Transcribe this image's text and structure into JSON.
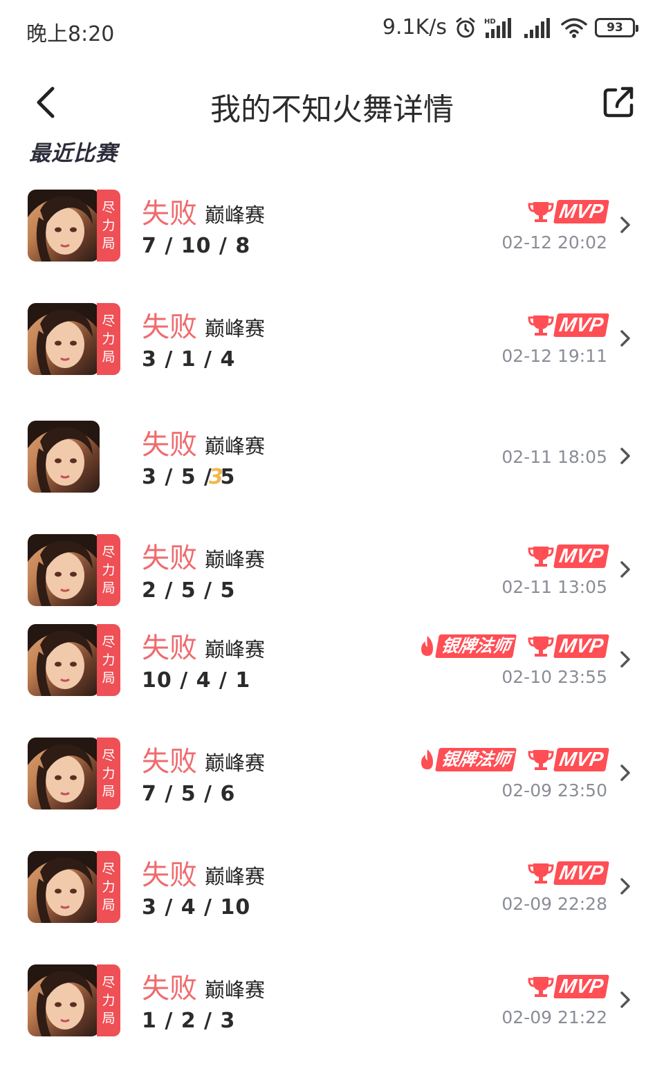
{
  "status_bar": {
    "time": "晚上8:20",
    "net_speed": "9.1K/s",
    "battery": "93"
  },
  "header": {
    "title": "我的不知火舞详情"
  },
  "section_title": "最近比赛",
  "matches": [
    {
      "badge": [
        "尽",
        "力",
        "局"
      ],
      "result": "失败",
      "mode": "巅峰赛",
      "kda": "7 / 10 / 8",
      "mvp_label": "MVP",
      "time": "02-12 20:02"
    },
    {
      "badge": [
        "尽",
        "力",
        "局"
      ],
      "result": "失败",
      "mode": "巅峰赛",
      "kda": "3 / 1 / 4",
      "mvp_label": "MVP",
      "time": "02-12 19:11"
    },
    {
      "result": "失败",
      "mode": "巅峰赛",
      "kda": "3 / 5 / 5",
      "kda_extra": "3",
      "time": "02-11 18:05"
    },
    {
      "badge": [
        "尽",
        "力",
        "局"
      ],
      "result": "失败",
      "mode": "巅峰赛",
      "kda": "2 / 5 / 5",
      "mvp_label": "MVP",
      "time": "02-11 13:05"
    },
    {
      "badge": [
        "尽",
        "力",
        "局"
      ],
      "result": "失败",
      "mode": "巅峰赛",
      "kda": "10 / 4 / 1",
      "silver_label": "银牌法师",
      "mvp_label": "MVP",
      "time": "02-10 23:55"
    },
    {
      "badge": [
        "尽",
        "力",
        "局"
      ],
      "result": "失败",
      "mode": "巅峰赛",
      "kda": "7 / 5 / 6",
      "silver_label": "银牌法师",
      "mvp_label": "MVP",
      "time": "02-09 23:50"
    },
    {
      "badge": [
        "尽",
        "力",
        "局"
      ],
      "result": "失败",
      "mode": "巅峰赛",
      "kda": "3 / 4 / 10",
      "mvp_label": "MVP",
      "time": "02-09 22:28"
    },
    {
      "badge": [
        "尽",
        "力",
        "局"
      ],
      "result": "失败",
      "mode": "巅峰赛",
      "kda": "1 / 2 / 3",
      "mvp_label": "MVP",
      "time": "02-09 21:22"
    }
  ],
  "colors": {
    "loss_red": "#ef6b6e",
    "badge_red": "#ee5055",
    "mvp_red": "#ff4e54",
    "time_gray": "#8a8d96"
  },
  "icons": {
    "back": "chevron-left-icon",
    "share": "share-icon",
    "row": "chevron-right-icon",
    "alarm": "alarm-icon",
    "signal": "signal-icon",
    "wifi": "wifi-icon",
    "battery": "battery-icon",
    "trophy": "trophy-icon",
    "flame": "flame-icon"
  }
}
